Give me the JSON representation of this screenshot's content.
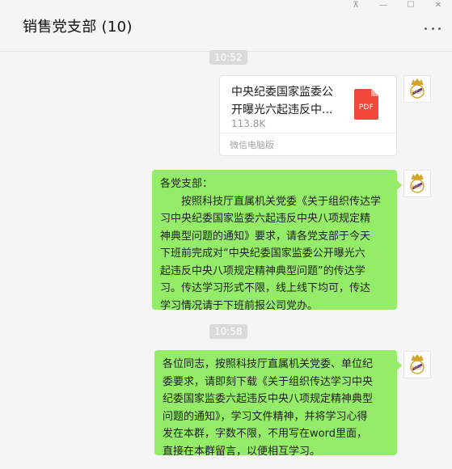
{
  "window": {
    "title": "销售党支部 (10)",
    "controls": {
      "pin": "⊼",
      "minimize": "—",
      "maximize": "☐",
      "close": "✕"
    }
  },
  "messages": [
    {
      "type": "timestamp",
      "text": "10:52"
    },
    {
      "type": "file",
      "file_name_lines": [
        "中央纪委国家监委公",
        "开曝光六起违反中..."
      ],
      "file_size": "113.8K",
      "file_type_label": "PDF",
      "source": "微信电脑版"
    },
    {
      "type": "text",
      "lines": [
        "各党支部：",
        "按照科技厅直属机关党委《关于组织传达学",
        "习中央纪委国家监委六起违反中央八项规定精",
        "神典型问题的通知》要求，请各党支部于今天",
        "下班前完成对“中央纪委国家监委公开曝光六",
        "起违反中央八项规定精神典型问题”的传达学",
        "习。传达学习形式不限，线上线下均可，传达",
        "学习情况请于下班前报公司党办。"
      ]
    },
    {
      "type": "timestamp",
      "text": "10:58"
    },
    {
      "type": "text",
      "lines": [
        "各位同志，按照科技厅直属机关党委、单位纪",
        "委要求，请即刻下载《关于组织传达学习中央",
        "纪委国家监委六起违反中央八项规定精神典型",
        "问题的通知》，学习文件精神，并将学习心得",
        "发在本群，字数不限，不用写在word里面，",
        "直接在本群留言，以便相互学习。"
      ]
    }
  ],
  "colors": {
    "bubble_green": "#95ec69",
    "background": "#f5f5f5",
    "pdf_red": "#f1493b",
    "avatar_gold": "#d4a52a",
    "avatar_purple": "#5a2d82"
  },
  "icons": {
    "more": "more-dots-icon",
    "file": "pdf-file-icon",
    "avatar": "real-madrid-crest-icon"
  }
}
